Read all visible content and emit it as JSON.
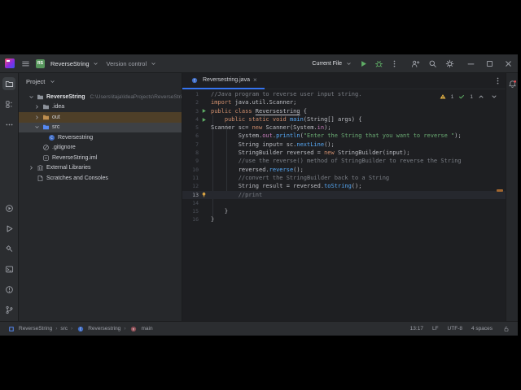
{
  "titlebar": {
    "project_abbrev": "RS",
    "project_name": "ReverseString",
    "vcs_label": "Version control",
    "run_config": "Current File",
    "run_group_icons": [
      "run",
      "debug",
      "more-vertical"
    ],
    "tool_group_icons": [
      "collaborate",
      "search",
      "settings"
    ],
    "window_control_icons": [
      "minimize",
      "maximize",
      "close"
    ]
  },
  "toolbar_left": {
    "top": [
      {
        "icon": "project",
        "selected": true
      },
      {
        "icon": "commit",
        "selected": false
      },
      {
        "icon": "more-horizontal",
        "selected": false
      }
    ],
    "bottom": [
      {
        "icon": "services",
        "selected": false
      },
      {
        "icon": "run",
        "selected": false
      },
      {
        "icon": "build",
        "selected": false
      },
      {
        "icon": "terminal",
        "selected": false
      },
      {
        "icon": "problems",
        "selected": false
      },
      {
        "icon": "git-branch",
        "selected": false
      }
    ]
  },
  "toolbar_right_icons": [
    "notifications"
  ],
  "project_panel": {
    "header": "Project",
    "tree": [
      {
        "label": "ReverseString",
        "path": "C:\\Users\\itaja\\IdeaProjects\\ReverseString",
        "icon": "folder",
        "chevron": "expanded",
        "level": 0,
        "root": true
      },
      {
        "label": ".idea",
        "icon": "folder",
        "chevron": "collapsed",
        "level": 1
      },
      {
        "label": "out",
        "icon": "folder-excluded",
        "chevron": "collapsed",
        "level": 1,
        "state": "excluded"
      },
      {
        "label": "src",
        "icon": "folder-source",
        "chevron": "expanded",
        "level": 1,
        "state": "selected"
      },
      {
        "label": "Reversestring",
        "icon": "class",
        "level": 2
      },
      {
        "label": ".gitignore",
        "icon": "ignored",
        "level": 1
      },
      {
        "label": "ReverseString.iml",
        "icon": "iml",
        "level": 1
      },
      {
        "label": "External Libraries",
        "icon": "libraries",
        "chevron": "collapsed",
        "level": 0
      },
      {
        "label": "Scratches and Consoles",
        "icon": "scratches",
        "level": 0
      }
    ]
  },
  "editor": {
    "tab": {
      "icon": "class",
      "title": "Reversestring.java",
      "close": "×"
    },
    "inspections": {
      "warnings": "1",
      "passed": "1"
    },
    "code": {
      "lines": [
        {
          "n": 1,
          "tokens": [
            {
              "t": "//Java program to reverse user input string.",
              "c": "cmt"
            }
          ]
        },
        {
          "n": 2,
          "tokens": [
            {
              "t": "import",
              "c": "kw"
            },
            {
              "t": " java.util.Scanner;",
              "c": "pl"
            }
          ]
        },
        {
          "n": 3,
          "gutter": "run-small",
          "tokens": [
            {
              "t": "public class ",
              "c": "kw"
            },
            {
              "t": "Reversestring",
              "c": "cls"
            },
            {
              "t": " {",
              "c": "pl"
            }
          ]
        },
        {
          "n": 4,
          "gutter": "run-small",
          "tokens": [
            {
              "t": "    ",
              "c": "pl"
            },
            {
              "t": "public static void ",
              "c": "kw"
            },
            {
              "t": "main",
              "c": "mth"
            },
            {
              "t": "(String[] args) {",
              "c": "pl"
            }
          ]
        },
        {
          "n": 5,
          "tokens": [
            {
              "t": "Scanner sc= ",
              "c": "pl"
            },
            {
              "t": "new",
              "c": "kw"
            },
            {
              "t": " Scanner(System.",
              "c": "pl"
            },
            {
              "t": "in",
              "c": "fld"
            },
            {
              "t": ");",
              "c": "pl"
            }
          ]
        },
        {
          "n": 6,
          "tokens": [
            {
              "t": "        System.",
              "c": "pl"
            },
            {
              "t": "out",
              "c": "fld"
            },
            {
              "t": ".",
              "c": "pl"
            },
            {
              "t": "println",
              "c": "mth"
            },
            {
              "t": "(",
              "c": "pl"
            },
            {
              "t": "\"Enter the String that you want to reverse \"",
              "c": "str"
            },
            {
              "t": ");",
              "c": "pl"
            }
          ]
        },
        {
          "n": 7,
          "tokens": [
            {
              "t": "        String input= sc.",
              "c": "pl"
            },
            {
              "t": "nextLine",
              "c": "mth"
            },
            {
              "t": "();",
              "c": "pl"
            }
          ]
        },
        {
          "n": 8,
          "tokens": [
            {
              "t": "        StringBuilder reversed = ",
              "c": "pl"
            },
            {
              "t": "new",
              "c": "kw"
            },
            {
              "t": " StringBuilder(input);",
              "c": "pl"
            }
          ]
        },
        {
          "n": 9,
          "tokens": [
            {
              "t": "        //use the reverse() method of StringBuilder to reverse the String",
              "c": "cmt"
            }
          ]
        },
        {
          "n": 10,
          "tokens": [
            {
              "t": "        reversed.",
              "c": "pl"
            },
            {
              "t": "reverse",
              "c": "mth"
            },
            {
              "t": "();",
              "c": "pl"
            }
          ]
        },
        {
          "n": 11,
          "tokens": [
            {
              "t": "        //convert the StringBuilder back to a String",
              "c": "cmt"
            }
          ]
        },
        {
          "n": 12,
          "tokens": [
            {
              "t": "        String result = reversed.",
              "c": "pl"
            },
            {
              "t": "toString",
              "c": "mth"
            },
            {
              "t": "();",
              "c": "pl"
            }
          ]
        },
        {
          "n": 13,
          "current": true,
          "gutter": "bulb",
          "tokens": [
            {
              "t": "        //print",
              "c": "cmt"
            }
          ]
        },
        {
          "n": 14,
          "tokens": []
        },
        {
          "n": 15,
          "tokens": [
            {
              "t": "    }",
              "c": "pl"
            }
          ]
        },
        {
          "n": 16,
          "tokens": [
            {
              "t": "}",
              "c": "pl"
            }
          ]
        }
      ]
    }
  },
  "status_bar": {
    "breadcrumbs": [
      {
        "icon": "project-square",
        "label": "ReverseString"
      },
      {
        "label": "src"
      },
      {
        "icon": "class",
        "label": "Reversestring"
      },
      {
        "icon": "method",
        "label": "main"
      }
    ],
    "caret": "13:17",
    "line_ending": "LF",
    "encoding": "UTF-8",
    "indent": "4 spaces",
    "lock_icon": "lock"
  },
  "colors": {
    "accent": "#3574f0",
    "run_green": "#5fad65",
    "warning_yellow": "#e8b545",
    "badge_green": "#57965c",
    "notification_red": "#e3484f",
    "excluded_row": "#4e3f28",
    "keyword_orange": "#cf8e6d",
    "string_green": "#6aab73"
  }
}
